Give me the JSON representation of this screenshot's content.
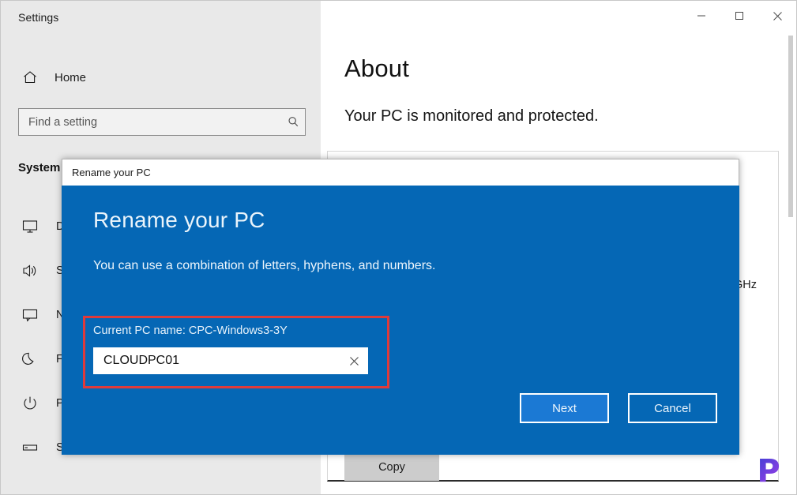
{
  "window": {
    "title": "Settings",
    "caption": {
      "minimize": "─",
      "maximize": "□",
      "close": "✕"
    }
  },
  "sidebar": {
    "home_label": "Home",
    "home_icon": "home-icon",
    "search": {
      "placeholder": "Find a setting",
      "value": "",
      "icon": "search-icon"
    },
    "group_header": "System",
    "items": [
      {
        "label": "Display",
        "icon": "monitor-icon"
      },
      {
        "label": "Sound",
        "icon": "speaker-icon"
      },
      {
        "label": "Notifications & actions",
        "icon": "chat-bubble-icon"
      },
      {
        "label": "Focus assist",
        "icon": "moon-icon"
      },
      {
        "label": "Power & sleep",
        "icon": "power-icon"
      },
      {
        "label": "Storage",
        "icon": "drive-icon"
      }
    ]
  },
  "main": {
    "page_title": "About",
    "subtitle": "Your PC is monitored and protected.",
    "spec_fragment": "GHz",
    "copy_label": "Copy"
  },
  "dialog": {
    "titlebar": "Rename your PC",
    "heading": "Rename your PC",
    "description": "You can use a combination of letters, hyphens, and numbers.",
    "current_pc_name_label": "Current PC name: CPC-Windows3-3Y",
    "name_input": {
      "value": "CLOUDPC01",
      "clear_icon": "close-icon"
    },
    "buttons": {
      "next": "Next",
      "cancel": "Cancel"
    },
    "accent_color": "#0567b5",
    "highlight_color": "#e03a3a",
    "primary_button_color": "#1b79d4"
  },
  "watermark": {
    "text": "P"
  }
}
